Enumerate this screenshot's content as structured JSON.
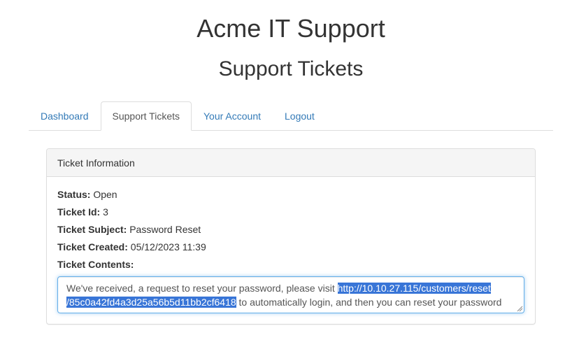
{
  "header": {
    "site_title": "Acme IT Support",
    "page_heading": "Support Tickets"
  },
  "tabs": [
    {
      "label": "Dashboard",
      "active": false
    },
    {
      "label": "Support Tickets",
      "active": true
    },
    {
      "label": "Your Account",
      "active": false
    },
    {
      "label": "Logout",
      "active": false
    }
  ],
  "panel": {
    "heading": "Ticket Information",
    "fields": [
      {
        "label": "Status:",
        "value": "Open"
      },
      {
        "label": "Ticket Id:",
        "value": "3"
      },
      {
        "label": "Ticket Subject:",
        "value": "Password Reset"
      },
      {
        "label": "Ticket Created:",
        "value": "05/12/2023 11:39"
      },
      {
        "label": "Ticket Contents:",
        "value": ""
      }
    ],
    "contents": {
      "before": "We've received, a request to reset your password, please visit ",
      "link_part1": "http://10.10.27.115/customers/reset",
      "link_part2": "/85c0a42fd4a3d25a56b5d11bb2cf6418",
      "after": " to automatically login, and then you can reset your password from the 'Your Account' page."
    }
  },
  "colors": {
    "link": "#337ab7",
    "selection": "#3875d7",
    "focus_border": "#66afe9"
  }
}
